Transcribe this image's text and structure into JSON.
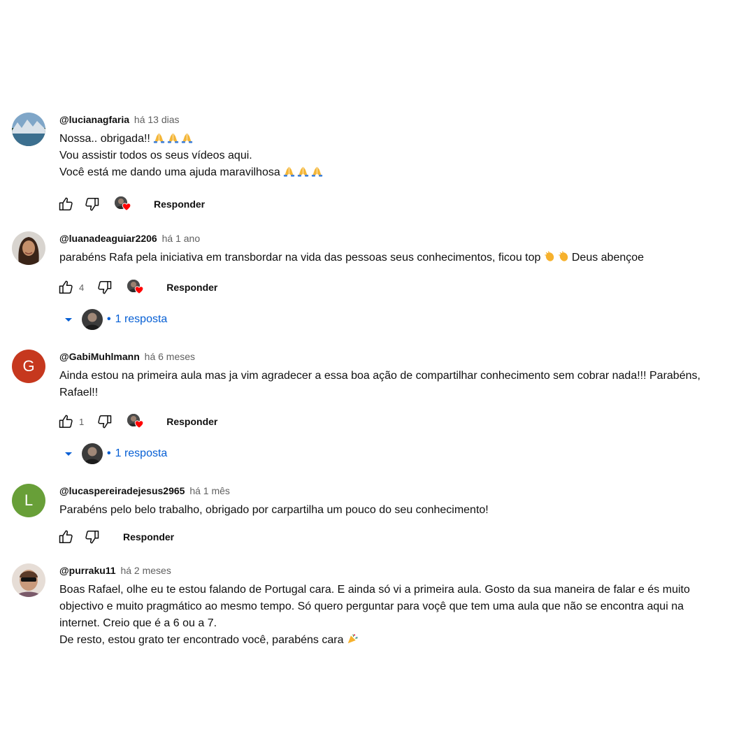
{
  "comments": [
    {
      "author": "@lucianagfaria",
      "time": "há 13 dias",
      "lines": [
        "Nossa.. obrigada!!",
        "Vou assistir todos os seus vídeos aqui.",
        "Você está me dando uma ajuda maravilhosa"
      ],
      "like_count": "",
      "reply_label": "Responder"
    },
    {
      "author": "@luanadeaguiar2206",
      "time": "há 1 ano",
      "lines": [
        "parabéns Rafa pela iniciativa em transbordar na vida das pessoas seus conhecimentos, ficou top",
        "Deus abençoe"
      ],
      "like_count": "4",
      "reply_label": "Responder",
      "replies": "1 resposta"
    },
    {
      "author": "@GabiMuhlmann",
      "time": "há 6 meses",
      "avatar_letter": "G",
      "lines": [
        "Ainda estou na primeira aula mas ja vim agradecer a essa boa ação de compartilhar conhecimento sem cobrar nada!!! Parabéns,",
        "Rafael!!"
      ],
      "like_count": "1",
      "reply_label": "Responder",
      "replies": "1 resposta"
    },
    {
      "author": "@lucaspereiradejesus2965",
      "time": "há 1 mês",
      "avatar_letter": "L",
      "lines": [
        "Parabéns pelo belo trabalho, obrigado por carpartilha um pouco do seu conhecimento!"
      ],
      "like_count": "",
      "reply_label": "Responder"
    },
    {
      "author": "@purraku11",
      "time": "há 2 meses",
      "lines": [
        "Boas Rafael, olhe eu te estou falando de Portugal cara. E ainda só vi a primeira aula. Gosto da sua maneira de falar e és muito",
        "objectivo e muito pragmático ao mesmo tempo. Só quero perguntar para voçê que tem uma aula que não se encontra aqui na",
        "internet. Creio que é a 6 ou a 7.",
        "De resto, estou grato ter encontrado você, parabéns cara"
      ],
      "like_count": "",
      "reply_label": "Responder"
    }
  ],
  "icons": {
    "like": "thumb-up-icon",
    "dislike": "thumb-down-icon",
    "creator_heart": "creator-heart-icon",
    "replies_caret": "chevron-down-icon",
    "pray": "folded-hands-emoji",
    "clap": "clapping-hands-emoji",
    "party": "party-popper-emoji"
  },
  "colors": {
    "link_blue": "#065fd4",
    "heart_red": "#ff0000",
    "avatar_g": "#c6381e",
    "avatar_l": "#689f38",
    "meta_gray": "#606060"
  }
}
